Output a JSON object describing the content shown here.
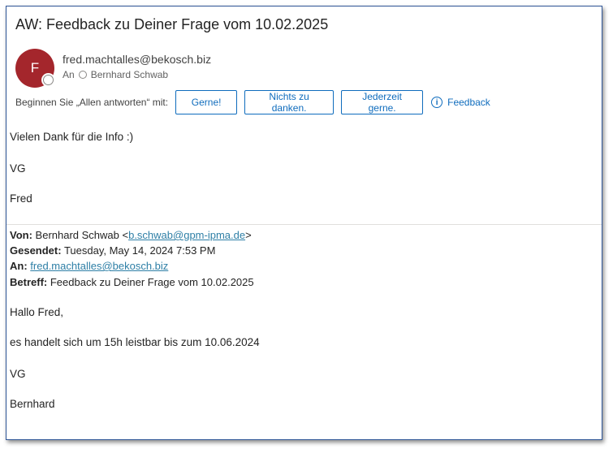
{
  "subject": "AW: Feedback zu Deiner Frage vom 10.02.2025",
  "sender": {
    "initial": "F",
    "email": "fred.machtalles@bekosch.biz",
    "to_label": "An",
    "to_name": "Bernhard Schwab",
    "avatar_color": "#a4262c"
  },
  "quick_replies": {
    "label": "Beginnen Sie „Allen antworten“ mit:",
    "options": [
      "Gerne!",
      "Nichts zu danken.",
      "Jederzeit gerne."
    ],
    "feedback": "Feedback"
  },
  "reply": {
    "lines": [
      "Vielen Dank für die Info :)",
      "VG",
      "Fred"
    ]
  },
  "quoted": {
    "from_label": "Von:",
    "from_name": "Bernhard Schwab <",
    "from_email": "b.schwab@gpm-ipma.de",
    "from_close": ">",
    "sent_label": "Gesendet:",
    "sent_value": "Tuesday, May 14, 2024 7:53 PM",
    "to_label": "An:",
    "to_email": "fred.machtalles@bekosch.biz",
    "subject_label": "Betreff:",
    "subject_value": "Feedback zu Deiner Frage vom 10.02.2025",
    "lines": [
      "Hallo Fred,",
      "es handelt sich um 15h leistbar bis zum 10.06.2024",
      "VG",
      "Bernhard"
    ]
  },
  "colors": {
    "accent": "#0f6cbd",
    "link": "#2e7fa6",
    "frame_border": "#2e5597"
  }
}
